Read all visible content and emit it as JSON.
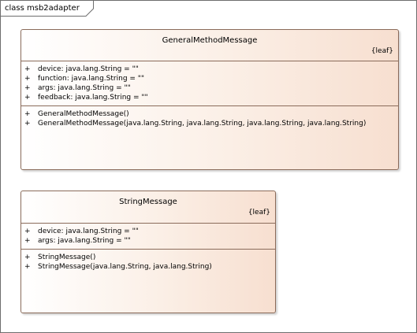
{
  "frame": {
    "title": "class msb2adapter"
  },
  "classes": [
    {
      "name": "GeneralMethodMessage",
      "stereotype": "{leaf}",
      "attributes": [
        {
          "visibility": "+",
          "text": "device: java.lang.String = \"\""
        },
        {
          "visibility": "+",
          "text": "function: java.lang.String = \"\""
        },
        {
          "visibility": "+",
          "text": "args: java.lang.String = \"\""
        },
        {
          "visibility": "+",
          "text": "feedback: java.lang.String = \"\""
        }
      ],
      "operations": [
        {
          "visibility": "+",
          "text": "GeneralMethodMessage()"
        },
        {
          "visibility": "+",
          "text": "GeneralMethodMessage(java.lang.String, java.lang.String, java.lang.String, java.lang.String)"
        }
      ]
    },
    {
      "name": "StringMessage",
      "stereotype": "{leaf}",
      "attributes": [
        {
          "visibility": "+",
          "text": "device: java.lang.String = \"\""
        },
        {
          "visibility": "+",
          "text": "args: java.lang.String = \"\""
        }
      ],
      "operations": [
        {
          "visibility": "+",
          "text": "StringMessage()"
        },
        {
          "visibility": "+",
          "text": "StringMessage(java.lang.String, java.lang.String)"
        }
      ]
    }
  ],
  "colors": {
    "box_border": "#8a6b5a",
    "box_fill_start": "#ffffff",
    "box_fill_end": "#f7dfd0",
    "frame_border": "#6e6e6e"
  }
}
